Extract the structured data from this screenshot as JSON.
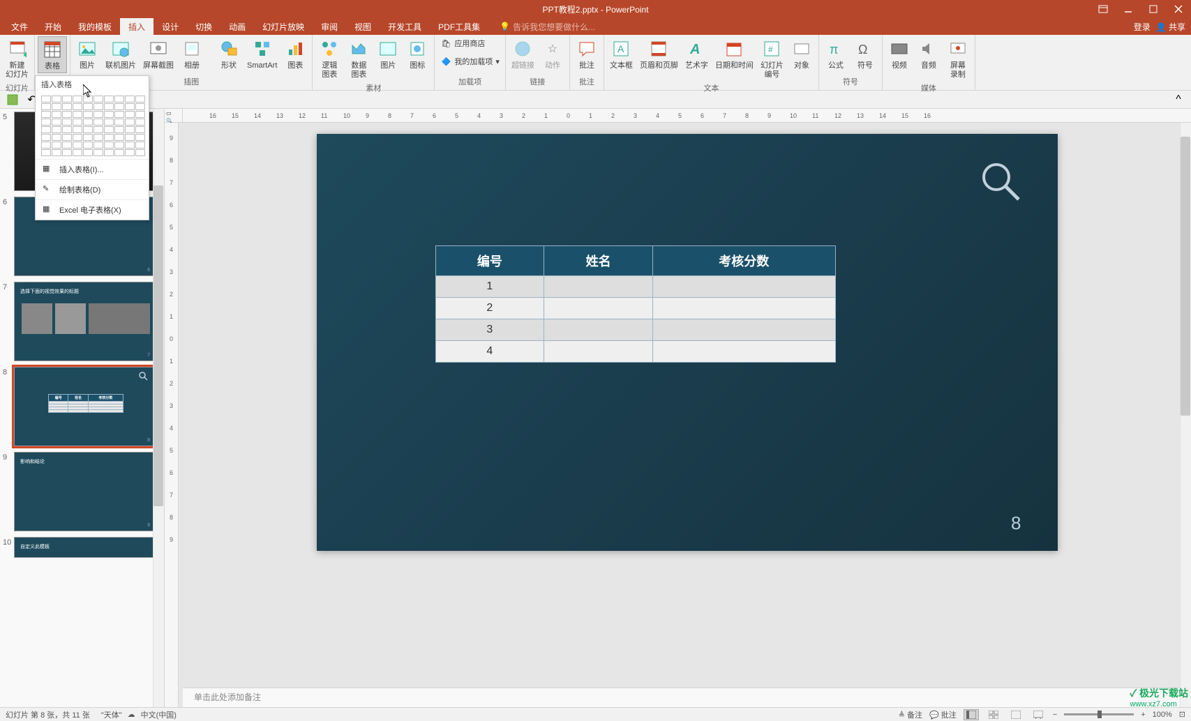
{
  "titlebar": {
    "title": "PPT教程2.pptx - PowerPoint"
  },
  "menubar": {
    "items": [
      "文件",
      "开始",
      "我的模板",
      "插入",
      "设计",
      "切换",
      "动画",
      "幻灯片放映",
      "审阅",
      "视图",
      "开发工具",
      "PDF工具集"
    ],
    "active_index": 3,
    "tell_me": "告诉我您想要做什么...",
    "login": "登录",
    "share": "共享"
  },
  "ribbon": {
    "groups": [
      {
        "label": "幻灯片",
        "buttons": [
          {
            "label": "新建\n幻灯片",
            "icon": "new-slide"
          }
        ]
      },
      {
        "label": "表格",
        "buttons": [
          {
            "label": "表格",
            "icon": "table",
            "selected": true
          }
        ]
      },
      {
        "label": "插图",
        "buttons": [
          {
            "label": "图片",
            "icon": "picture"
          },
          {
            "label": "联机图片",
            "icon": "online-pic"
          },
          {
            "label": "屏幕截图",
            "icon": "screenshot"
          },
          {
            "label": "相册",
            "icon": "album"
          },
          {
            "label": "形状",
            "icon": "shapes"
          },
          {
            "label": "SmartArt",
            "icon": "smartart"
          },
          {
            "label": "图表",
            "icon": "chart"
          }
        ]
      },
      {
        "label": "素材",
        "buttons": [
          {
            "label": "逻辑\n图表",
            "icon": "logic-chart"
          },
          {
            "label": "数据\n图表",
            "icon": "data-chart"
          },
          {
            "label": "图片",
            "icon": "pic2"
          },
          {
            "label": "图标",
            "icon": "icon"
          }
        ]
      },
      {
        "label": "加载项",
        "compact": true,
        "items": [
          "应用商店",
          "我的加载项"
        ]
      },
      {
        "label": "链接",
        "buttons": [
          {
            "label": "超链接",
            "icon": "hyperlink"
          },
          {
            "label": "动作",
            "icon": "action"
          }
        ]
      },
      {
        "label": "批注",
        "buttons": [
          {
            "label": "批注",
            "icon": "comment"
          }
        ]
      },
      {
        "label": "文本",
        "buttons": [
          {
            "label": "文本框",
            "icon": "textbox"
          },
          {
            "label": "页眉和页脚",
            "icon": "header-footer"
          },
          {
            "label": "艺术字",
            "icon": "wordart"
          },
          {
            "label": "日期和时间",
            "icon": "datetime"
          },
          {
            "label": "幻灯片\n编号",
            "icon": "slide-num"
          },
          {
            "label": "对象",
            "icon": "object"
          }
        ]
      },
      {
        "label": "符号",
        "buttons": [
          {
            "label": "公式",
            "icon": "equation"
          },
          {
            "label": "符号",
            "icon": "symbol"
          }
        ]
      },
      {
        "label": "媒体",
        "buttons": [
          {
            "label": "视频",
            "icon": "video"
          },
          {
            "label": "音频",
            "icon": "audio"
          },
          {
            "label": "屏幕\n录制",
            "icon": "screen-rec"
          }
        ]
      }
    ]
  },
  "table_dropdown": {
    "title": "插入表格",
    "items": [
      "插入表格(I)...",
      "绘制表格(D)",
      "Excel 电子表格(X)"
    ]
  },
  "ruler_h": [
    "16",
    "15",
    "14",
    "13",
    "12",
    "11",
    "10",
    "9",
    "8",
    "7",
    "6",
    "5",
    "4",
    "3",
    "2",
    "1",
    "0",
    "1",
    "2",
    "3",
    "4",
    "5",
    "6",
    "7",
    "8",
    "9",
    "10",
    "11",
    "12",
    "13",
    "14",
    "15",
    "16"
  ],
  "ruler_v": [
    "9",
    "8",
    "7",
    "6",
    "5",
    "4",
    "3",
    "2",
    "1",
    "0",
    "1",
    "2",
    "3",
    "4",
    "5",
    "6",
    "7",
    "8",
    "9"
  ],
  "slides": [
    {
      "num": "5"
    },
    {
      "num": "6"
    },
    {
      "num": "7",
      "title": "选择下面的视觉效果的标题"
    },
    {
      "num": "8",
      "selected": true
    },
    {
      "num": "9",
      "title": "影响和结论"
    },
    {
      "num": "10",
      "title": "自定义此模板"
    }
  ],
  "slide_content": {
    "headers": [
      "编号",
      "姓名",
      "考核分数"
    ],
    "rows": [
      "1",
      "2",
      "3",
      "4"
    ],
    "page_num": "8"
  },
  "notes": "单击此处添加备注",
  "statusbar": {
    "slide_info": "幻灯片 第 8 张，共 11 张",
    "theme": "\"天体\"",
    "lang": "中文(中国)",
    "notes_btn": "备注",
    "comments_btn": "批注",
    "zoom": "100%"
  },
  "watermark": {
    "name": "极光下载站",
    "url": "www.xz7.com"
  }
}
